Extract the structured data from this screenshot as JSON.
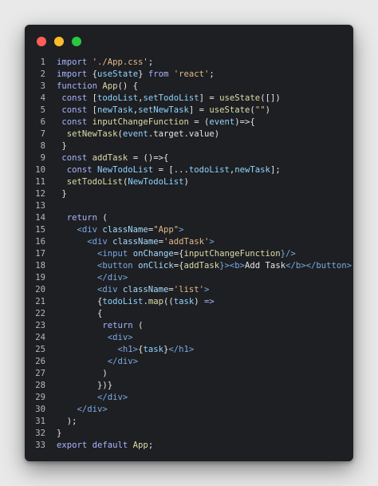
{
  "window": {
    "title": ""
  },
  "code_lines": [
    {
      "n": "1",
      "tokens": [
        {
          "t": "import ",
          "c": "kw"
        },
        {
          "t": "'./App.css'",
          "c": "str"
        },
        {
          "t": ";",
          "c": "pl"
        }
      ]
    },
    {
      "n": "2",
      "tokens": [
        {
          "t": "import ",
          "c": "kw"
        },
        {
          "t": "{",
          "c": "pl"
        },
        {
          "t": "useState",
          "c": "var"
        },
        {
          "t": "} ",
          "c": "pl"
        },
        {
          "t": "from ",
          "c": "kw"
        },
        {
          "t": "'react'",
          "c": "str"
        },
        {
          "t": ";",
          "c": "pl"
        }
      ]
    },
    {
      "n": "3",
      "tokens": [
        {
          "t": "function ",
          "c": "kw"
        },
        {
          "t": "App",
          "c": "fn"
        },
        {
          "t": "() {",
          "c": "pl"
        }
      ]
    },
    {
      "n": "4",
      "tokens": [
        {
          "t": " const ",
          "c": "kw"
        },
        {
          "t": "[",
          "c": "pl"
        },
        {
          "t": "todoList",
          "c": "var"
        },
        {
          "t": ",",
          "c": "pl"
        },
        {
          "t": "setTodoList",
          "c": "var"
        },
        {
          "t": "] = ",
          "c": "pl"
        },
        {
          "t": "useState",
          "c": "fn"
        },
        {
          "t": "([])",
          "c": "pl"
        }
      ]
    },
    {
      "n": "5",
      "tokens": [
        {
          "t": " const ",
          "c": "kw"
        },
        {
          "t": "[",
          "c": "pl"
        },
        {
          "t": "newTask",
          "c": "var"
        },
        {
          "t": ",",
          "c": "pl"
        },
        {
          "t": "setNewTask",
          "c": "var"
        },
        {
          "t": "] = ",
          "c": "pl"
        },
        {
          "t": "useState",
          "c": "fn"
        },
        {
          "t": "(",
          "c": "pl"
        },
        {
          "t": "\"\"",
          "c": "str"
        },
        {
          "t": ")",
          "c": "pl"
        }
      ]
    },
    {
      "n": "6",
      "tokens": [
        {
          "t": " const ",
          "c": "kw"
        },
        {
          "t": "inputChangeFunction",
          "c": "fn"
        },
        {
          "t": " = (",
          "c": "pl"
        },
        {
          "t": "event",
          "c": "var"
        },
        {
          "t": ")=>{",
          "c": "pl"
        }
      ]
    },
    {
      "n": "7",
      "tokens": [
        {
          "t": "  ",
          "c": "pl"
        },
        {
          "t": "setNewTask",
          "c": "fn"
        },
        {
          "t": "(",
          "c": "pl"
        },
        {
          "t": "event",
          "c": "var"
        },
        {
          "t": ".target.value)",
          "c": "pl"
        }
      ]
    },
    {
      "n": "8",
      "tokens": [
        {
          "t": " }",
          "c": "pl"
        }
      ]
    },
    {
      "n": "9",
      "tokens": [
        {
          "t": " const ",
          "c": "kw"
        },
        {
          "t": "addTask",
          "c": "fn"
        },
        {
          "t": " = ()=>{",
          "c": "pl"
        }
      ]
    },
    {
      "n": "10",
      "tokens": [
        {
          "t": "  const ",
          "c": "kw"
        },
        {
          "t": "NewTodoList",
          "c": "var"
        },
        {
          "t": " = [...",
          "c": "pl"
        },
        {
          "t": "todoList",
          "c": "var"
        },
        {
          "t": ",",
          "c": "pl"
        },
        {
          "t": "newTask",
          "c": "var"
        },
        {
          "t": "];",
          "c": "pl"
        }
      ]
    },
    {
      "n": "11",
      "tokens": [
        {
          "t": "  ",
          "c": "pl"
        },
        {
          "t": "setTodoList",
          "c": "fn"
        },
        {
          "t": "(",
          "c": "pl"
        },
        {
          "t": "NewTodoList",
          "c": "var"
        },
        {
          "t": ")",
          "c": "pl"
        }
      ]
    },
    {
      "n": "12",
      "tokens": [
        {
          "t": " }",
          "c": "pl"
        }
      ]
    },
    {
      "n": "13",
      "tokens": []
    },
    {
      "n": "14",
      "tokens": [
        {
          "t": "  return ",
          "c": "kw"
        },
        {
          "t": "(",
          "c": "pl"
        }
      ]
    },
    {
      "n": "15",
      "tokens": [
        {
          "t": "    <",
          "c": "tag"
        },
        {
          "t": "div ",
          "c": "tag"
        },
        {
          "t": "className",
          "c": "attr"
        },
        {
          "t": "=",
          "c": "pl"
        },
        {
          "t": "\"App\"",
          "c": "str"
        },
        {
          "t": ">",
          "c": "tag"
        }
      ]
    },
    {
      "n": "16",
      "tokens": [
        {
          "t": "      <",
          "c": "tag"
        },
        {
          "t": "div ",
          "c": "tag"
        },
        {
          "t": "className",
          "c": "attr"
        },
        {
          "t": "=",
          "c": "pl"
        },
        {
          "t": "'addTask'",
          "c": "str"
        },
        {
          "t": ">",
          "c": "tag"
        }
      ]
    },
    {
      "n": "17",
      "tokens": [
        {
          "t": "        <",
          "c": "tag"
        },
        {
          "t": "input ",
          "c": "tag"
        },
        {
          "t": "onChange",
          "c": "attr"
        },
        {
          "t": "={",
          "c": "pl"
        },
        {
          "t": "inputChangeFunction",
          "c": "fn"
        },
        {
          "t": "}/>",
          "c": "tag"
        }
      ]
    },
    {
      "n": "18",
      "tokens": [
        {
          "t": "        <",
          "c": "tag"
        },
        {
          "t": "button ",
          "c": "tag"
        },
        {
          "t": "onClick",
          "c": "attr"
        },
        {
          "t": "={",
          "c": "pl"
        },
        {
          "t": "addTask",
          "c": "fn"
        },
        {
          "t": "}>",
          "c": "tag"
        },
        {
          "t": "<b>",
          "c": "tag"
        },
        {
          "t": "Add Task",
          "c": "pl"
        },
        {
          "t": "</b></button>",
          "c": "tag"
        }
      ]
    },
    {
      "n": "19",
      "tokens": [
        {
          "t": "        </div>",
          "c": "tag"
        }
      ]
    },
    {
      "n": "20",
      "tokens": [
        {
          "t": "        <",
          "c": "tag"
        },
        {
          "t": "div ",
          "c": "tag"
        },
        {
          "t": "className",
          "c": "attr"
        },
        {
          "t": "=",
          "c": "pl"
        },
        {
          "t": "'list'",
          "c": "str"
        },
        {
          "t": ">",
          "c": "tag"
        }
      ]
    },
    {
      "n": "21",
      "tokens": [
        {
          "t": "        {",
          "c": "pl"
        },
        {
          "t": "todoList",
          "c": "var"
        },
        {
          "t": ".",
          "c": "pl"
        },
        {
          "t": "map",
          "c": "fn"
        },
        {
          "t": "((",
          "c": "pl"
        },
        {
          "t": "task",
          "c": "var"
        },
        {
          "t": ") ",
          "c": "pl"
        },
        {
          "t": "=>",
          "c": "kw"
        }
      ]
    },
    {
      "n": "22",
      "tokens": [
        {
          "t": "        {",
          "c": "pl"
        }
      ]
    },
    {
      "n": "23",
      "tokens": [
        {
          "t": "         return ",
          "c": "kw"
        },
        {
          "t": "(",
          "c": "pl"
        }
      ]
    },
    {
      "n": "24",
      "tokens": [
        {
          "t": "          <div>",
          "c": "tag"
        }
      ]
    },
    {
      "n": "25",
      "tokens": [
        {
          "t": "            <h1>",
          "c": "tag"
        },
        {
          "t": "{",
          "c": "pl"
        },
        {
          "t": "task",
          "c": "var"
        },
        {
          "t": "}",
          "c": "pl"
        },
        {
          "t": "</h1>",
          "c": "tag"
        }
      ]
    },
    {
      "n": "26",
      "tokens": [
        {
          "t": "          </div>",
          "c": "tag"
        }
      ]
    },
    {
      "n": "27",
      "tokens": [
        {
          "t": "         )",
          "c": "pl"
        }
      ]
    },
    {
      "n": "28",
      "tokens": [
        {
          "t": "        })}",
          "c": "pl"
        }
      ]
    },
    {
      "n": "29",
      "tokens": [
        {
          "t": "        </div>",
          "c": "tag"
        }
      ]
    },
    {
      "n": "30",
      "tokens": [
        {
          "t": "    </div>",
          "c": "tag"
        }
      ]
    },
    {
      "n": "31",
      "tokens": [
        {
          "t": "  );",
          "c": "pl"
        }
      ]
    },
    {
      "n": "32",
      "tokens": [
        {
          "t": "}",
          "c": "pl"
        }
      ]
    },
    {
      "n": "33",
      "tokens": [
        {
          "t": "export default ",
          "c": "kw"
        },
        {
          "t": "App",
          "c": "fn"
        },
        {
          "t": ";",
          "c": "pl"
        }
      ]
    }
  ],
  "colors": {
    "background": "#e9e9e9",
    "editor_background": "#1e1f22",
    "close_dot": "#fe5f57",
    "minimize_dot": "#fdbc2e",
    "maximize_dot": "#28c840"
  }
}
